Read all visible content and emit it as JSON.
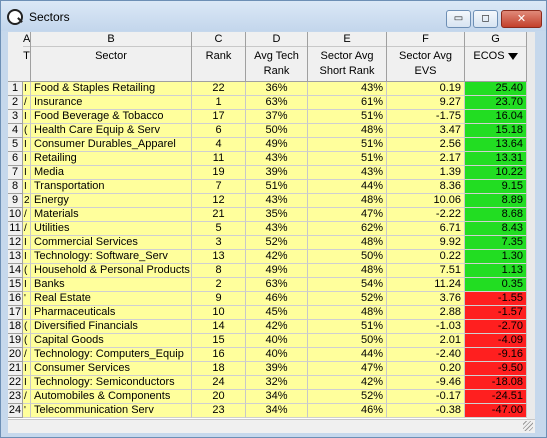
{
  "window": {
    "title": "Sectors",
    "minimize_glyph": "▭",
    "maximize_glyph": "◻",
    "close_glyph": "✕"
  },
  "columns": [
    {
      "letter": "A",
      "label": "T"
    },
    {
      "letter": "B",
      "label": "Sector"
    },
    {
      "letter": "C",
      "label": "Rank"
    },
    {
      "letter": "D",
      "label": "Avg Tech Rank"
    },
    {
      "letter": "E",
      "label": "Sector Avg Short Rank"
    },
    {
      "letter": "F",
      "label": "Sector Avg EVS"
    },
    {
      "letter": "G",
      "label": "ECOS"
    }
  ],
  "rows": [
    {
      "num": "1",
      "a": "I",
      "sector": "Food & Staples Retailing",
      "rank": "22",
      "avg_tech": "36%",
      "short": "43%",
      "evs": "0.19",
      "ecos": "25.40",
      "sign": "pos"
    },
    {
      "num": "2",
      "a": "/",
      "sector": "Insurance",
      "rank": "1",
      "avg_tech": "63%",
      "short": "61%",
      "evs": "9.27",
      "ecos": "23.70",
      "sign": "pos"
    },
    {
      "num": "3",
      "a": "I",
      "sector": "Food Beverage & Tobacco",
      "rank": "17",
      "avg_tech": "37%",
      "short": "51%",
      "evs": "-1.75",
      "ecos": "16.04",
      "sign": "pos"
    },
    {
      "num": "4",
      "a": "(",
      "sector": "Health Care Equip & Serv",
      "rank": "6",
      "avg_tech": "50%",
      "short": "48%",
      "evs": "3.47",
      "ecos": "15.18",
      "sign": "pos"
    },
    {
      "num": "5",
      "a": "I",
      "sector": "Consumer Durables_Apparel",
      "rank": "4",
      "avg_tech": "49%",
      "short": "51%",
      "evs": "2.56",
      "ecos": "13.64",
      "sign": "pos"
    },
    {
      "num": "6",
      "a": "I",
      "sector": "Retailing",
      "rank": "11",
      "avg_tech": "43%",
      "short": "51%",
      "evs": "2.17",
      "ecos": "13.31",
      "sign": "pos"
    },
    {
      "num": "7",
      "a": "I",
      "sector": "Media",
      "rank": "19",
      "avg_tech": "39%",
      "short": "43%",
      "evs": "1.39",
      "ecos": "10.22",
      "sign": "pos"
    },
    {
      "num": "8",
      "a": "I",
      "sector": "Transportation",
      "rank": "7",
      "avg_tech": "51%",
      "short": "44%",
      "evs": "8.36",
      "ecos": "9.15",
      "sign": "pos"
    },
    {
      "num": "9",
      "a": "2",
      "sector": "Energy",
      "rank": "12",
      "avg_tech": "43%",
      "short": "48%",
      "evs": "10.06",
      "ecos": "8.89",
      "sign": "pos"
    },
    {
      "num": "10",
      "a": "/",
      "sector": "Materials",
      "rank": "21",
      "avg_tech": "35%",
      "short": "47%",
      "evs": "-2.22",
      "ecos": "8.68",
      "sign": "pos"
    },
    {
      "num": "11",
      "a": "/",
      "sector": "Utilities",
      "rank": "5",
      "avg_tech": "43%",
      "short": "62%",
      "evs": "6.71",
      "ecos": "8.43",
      "sign": "pos"
    },
    {
      "num": "12",
      "a": "I",
      "sector": "Commercial Services",
      "rank": "3",
      "avg_tech": "52%",
      "short": "48%",
      "evs": "9.92",
      "ecos": "7.35",
      "sign": "pos"
    },
    {
      "num": "13",
      "a": "I",
      "sector": "Technology: Software_Serv",
      "rank": "13",
      "avg_tech": "42%",
      "short": "50%",
      "evs": "0.22",
      "ecos": "1.30",
      "sign": "pos"
    },
    {
      "num": "14",
      "a": "(",
      "sector": "Household & Personal Products",
      "rank": "8",
      "avg_tech": "49%",
      "short": "48%",
      "evs": "7.51",
      "ecos": "1.13",
      "sign": "pos"
    },
    {
      "num": "15",
      "a": "I",
      "sector": "Banks",
      "rank": "2",
      "avg_tech": "63%",
      "short": "54%",
      "evs": "11.24",
      "ecos": "0.35",
      "sign": "pos"
    },
    {
      "num": "16",
      "a": "'",
      "sector": "Real Estate",
      "rank": "9",
      "avg_tech": "46%",
      "short": "52%",
      "evs": "3.76",
      "ecos": "-1.55",
      "sign": "neg"
    },
    {
      "num": "17",
      "a": "I",
      "sector": "Pharmaceuticals",
      "rank": "10",
      "avg_tech": "45%",
      "short": "48%",
      "evs": "2.88",
      "ecos": "-1.57",
      "sign": "neg"
    },
    {
      "num": "18",
      "a": "(",
      "sector": "Diversified Financials",
      "rank": "14",
      "avg_tech": "42%",
      "short": "51%",
      "evs": "-1.03",
      "ecos": "-2.70",
      "sign": "neg"
    },
    {
      "num": "19",
      "a": "(",
      "sector": "Capital Goods",
      "rank": "15",
      "avg_tech": "40%",
      "short": "50%",
      "evs": "2.01",
      "ecos": "-4.09",
      "sign": "neg"
    },
    {
      "num": "20",
      "a": "/",
      "sector": "Technology: Computers_Equip",
      "rank": "16",
      "avg_tech": "40%",
      "short": "44%",
      "evs": "-2.40",
      "ecos": "-9.16",
      "sign": "neg"
    },
    {
      "num": "21",
      "a": "I",
      "sector": "Consumer Services",
      "rank": "18",
      "avg_tech": "39%",
      "short": "47%",
      "evs": "0.20",
      "ecos": "-9.50",
      "sign": "neg"
    },
    {
      "num": "22",
      "a": "I",
      "sector": "Technology: Semiconductors",
      "rank": "24",
      "avg_tech": "32%",
      "short": "42%",
      "evs": "-9.46",
      "ecos": "-18.08",
      "sign": "neg"
    },
    {
      "num": "23",
      "a": "/",
      "sector": "Automobiles & Components",
      "rank": "20",
      "avg_tech": "34%",
      "short": "52%",
      "evs": "-0.17",
      "ecos": "-24.51",
      "sign": "neg"
    },
    {
      "num": "24",
      "a": "'",
      "sector": "Telecommunication Serv",
      "rank": "23",
      "avg_tech": "34%",
      "short": "46%",
      "evs": "-0.38",
      "ecos": "-47.00",
      "sign": "neg"
    }
  ],
  "colors": {
    "cell_fill": "#ffff9c",
    "positive": "#22dd22",
    "negative": "#ff1f1f",
    "header": "#f0f0f0",
    "frame": "#c6d8ec"
  },
  "icons": {
    "app": "search-q-icon",
    "sort": "sort-desc-icon"
  }
}
